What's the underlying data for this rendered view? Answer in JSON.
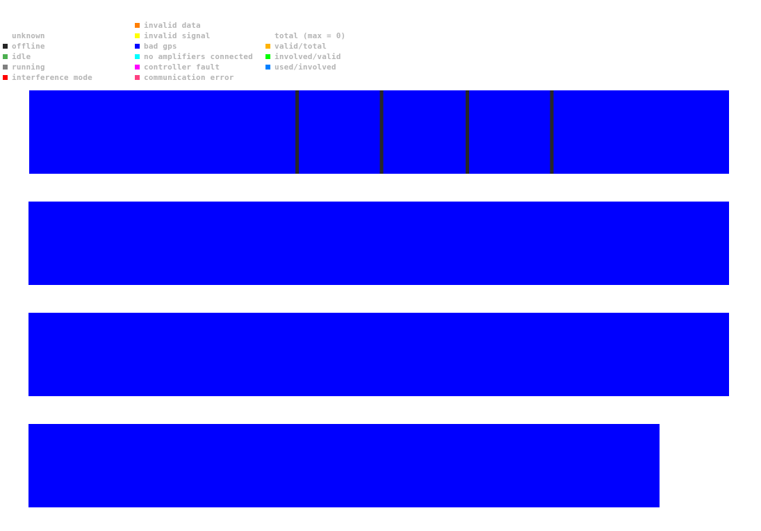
{
  "legend": {
    "columns": [
      {
        "items": [
          {
            "label": "unknown",
            "color": null
          },
          {
            "label": "offline",
            "color": "#262626"
          },
          {
            "label": "idle",
            "color": "#4caf50"
          },
          {
            "label": "running",
            "color": "#808080"
          },
          {
            "label": "interference mode",
            "color": "#ff0000"
          }
        ]
      },
      {
        "items": [
          {
            "label": "invalid data",
            "color": "#ff7f00"
          },
          {
            "label": "invalid signal",
            "color": "#ffff00"
          },
          {
            "label": "bad gps",
            "color": "#0000ff"
          },
          {
            "label": "no amplifiers connected",
            "color": "#00ffff"
          },
          {
            "label": "controller fault",
            "color": "#ff00ff"
          },
          {
            "label": "communication error",
            "color": "#ff4081"
          }
        ]
      },
      {
        "items": [
          {
            "label": "total (max = 0)",
            "color": null
          },
          {
            "label": "valid/total",
            "color": "#ffb300"
          },
          {
            "label": "involved/valid",
            "color": "#00ff00"
          },
          {
            "label": "used/involved",
            "color": "#0080ff"
          }
        ]
      }
    ]
  },
  "chart_data": {
    "type": "bar",
    "orientation": "horizontal-timeline",
    "title": "",
    "xlabel": "",
    "ylabel": "",
    "grid": false,
    "legend_position": "top-left",
    "x_range": [
      0,
      1
    ],
    "rows": [
      {
        "name": "row-1",
        "segments": [
          {
            "state": "bad gps",
            "color": "#0000ff",
            "start": 0.0,
            "end": 1.0
          }
        ],
        "separators": [
          0.3835,
          0.504,
          0.6265,
          0.747
        ],
        "separator_color": "#262626"
      },
      {
        "name": "row-2",
        "segments": [
          {
            "state": "bad gps",
            "color": "#0000ff",
            "start": 0.0,
            "end": 1.0
          }
        ],
        "separators": []
      },
      {
        "name": "row-3",
        "segments": [
          {
            "state": "bad gps",
            "color": "#0000ff",
            "start": 0.0,
            "end": 1.0
          }
        ],
        "separators": []
      },
      {
        "name": "row-4",
        "segments": [
          {
            "state": "bad gps",
            "color": "#0000ff",
            "start": 0.0,
            "end": 0.9008
          }
        ],
        "separators": []
      }
    ]
  }
}
